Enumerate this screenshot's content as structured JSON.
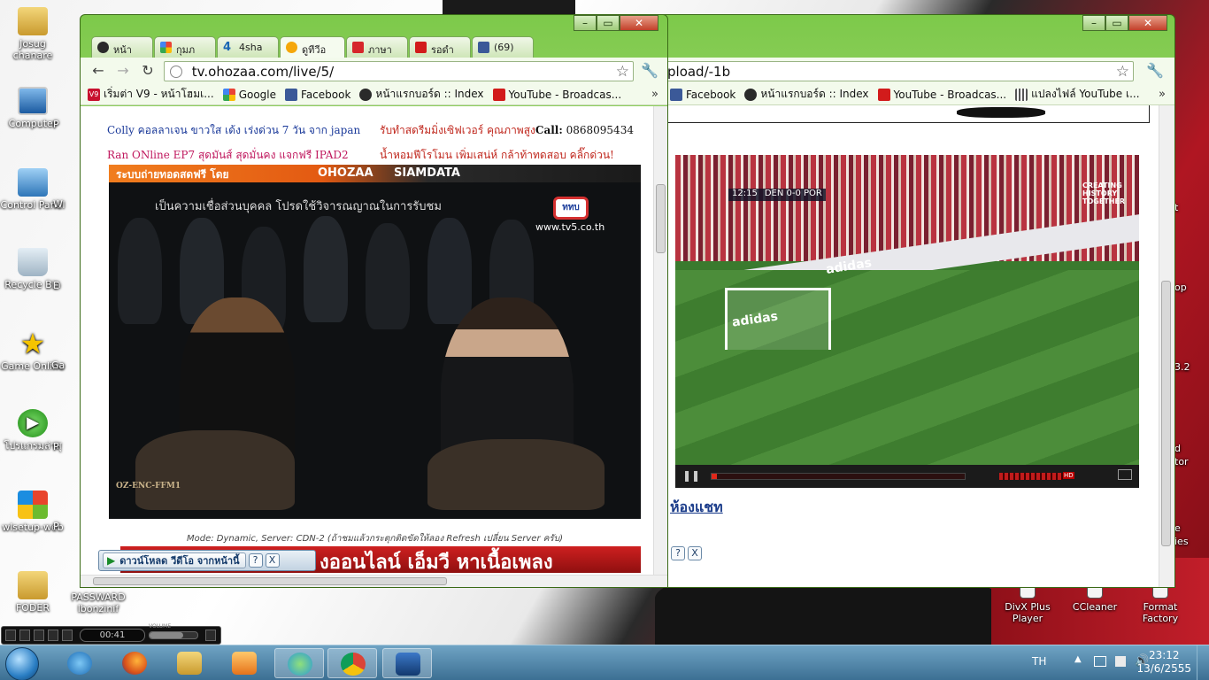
{
  "desktop": {
    "icons": [
      {
        "label": "Josug chanare",
        "name": "folder-icon"
      },
      {
        "label": "Computer",
        "name": "computer-icon"
      },
      {
        "label": "Control Panel",
        "name": "control-panel-icon"
      },
      {
        "label": "Recycle Bin",
        "name": "recycle-bin-icon"
      },
      {
        "label": "Game Online",
        "name": "star-icon"
      },
      {
        "label": "โปรแกรมล่าสุ",
        "name": "play-icon"
      },
      {
        "label": "wlsetup-web",
        "name": "windows-logo-icon"
      },
      {
        "label": "FODER",
        "name": "folder-icon"
      },
      {
        "label": "PASSWARD lbonzinif",
        "name": "text-file-icon"
      }
    ],
    "right_icons": [
      {
        "label": "DivX Plus Player",
        "name": "divx-icon"
      },
      {
        "label": "CCleaner",
        "name": "ccleaner-icon"
      },
      {
        "label": "Format Factory",
        "name": "format-factory-icon"
      }
    ],
    "partial_labels": {
      "pc": "P",
      "w": "W",
      "e": "E",
      "ga": "Ga",
      "p2": "P",
      "p3": "P"
    },
    "right_partial": {
      "t": "t",
      "op": "op",
      "v32": "3.2",
      "d": "d",
      "tor": "tor",
      "e": "e",
      "ies": "ies"
    }
  },
  "left_window": {
    "tabs": [
      {
        "label": "หน้า"
      },
      {
        "label": "กุมภ"
      },
      {
        "label": "4sha"
      },
      {
        "label": "ดูทีวีอ"
      },
      {
        "label": "ภาษา"
      },
      {
        "label": "รอดำ"
      },
      {
        "label": "(69)"
      }
    ],
    "url": "tv.ohozaa.com/live/5/",
    "bookmarks": [
      {
        "label": "เริ่มต่า V9 - หน้าโฮมเ..."
      },
      {
        "label": "Google"
      },
      {
        "label": "Facebook"
      },
      {
        "label": "หน้าแรกบอร์ด :: Index"
      },
      {
        "label": "YouTube - Broadcas..."
      }
    ],
    "chevron": "»",
    "ads": {
      "a1": "Colly คอลลาเจน ขาวใส เด้ง เร่งด่วน 7 วัน จาก japan",
      "a2": "รับทำสดรีมมิ่งเซิฟเวอร์ คุณภาพสูง",
      "a2_call": "Call:",
      "a2_phone": "0868095434",
      "a3": "Ran ONline EP7 สุดมันส์ สุดมั่นคง แจกฟรี IPAD2",
      "a4": "น้ำหอมฟีโรโมน เพิ่มเสน่ห์ กล้าท้าทดสอบ คลิ๊กด่วน!"
    },
    "video": {
      "banner_left": "ระบบถ่ายทอดสดฟรี โดย",
      "banner_ohozaa": "OHOZAA",
      "banner_siamdata": "SIAMDATA",
      "subtitle": "เป็นความเชื่อส่วนบุคคล โปรดใช้วิจารณญาณในการรับชม",
      "channel_logo": "ททบ",
      "channel_url": "www.tv5.co.th",
      "encoder": "OZ-ENC-FFM1"
    },
    "mode_text": "Mode: Dynamic, Server: CDN-2 (ถ้าชมแล้วกระตุกติดขัดให้ลอง Refresh เปลี่ยน Server ครับ)",
    "red_banner": "งออนไลน์ เอ็มวี หาเนื้อเพลง",
    "download_bar": {
      "label": "ดาวน์โหลด วีดีโอ จากหน้านี้",
      "help": "?",
      "close": "X"
    }
  },
  "right_window": {
    "url_partial": "pload/-1b",
    "bookmarks": [
      {
        "label": "Facebook"
      },
      {
        "label": "หน้าแรกบอร์ด :: Index"
      },
      {
        "label": "YouTube - Broadcas..."
      },
      {
        "label": "แปลงไฟล์ YouTube เ..."
      }
    ],
    "chevron": "»",
    "video": {
      "score_time": "12:15",
      "score": "DEN 0-0 POR",
      "sponsor": "adidas",
      "corner_text": "CREATING HISTORY TOGETHER",
      "hd": "HD"
    },
    "chat_link": "ห้องแชท",
    "buttons": {
      "help": "?",
      "close": "X"
    }
  },
  "media_player": {
    "time": "00:41",
    "vol_label": "VOLUME"
  },
  "taskbar": {
    "language": "TH",
    "time": "23:12",
    "date": "13/6/2555"
  }
}
